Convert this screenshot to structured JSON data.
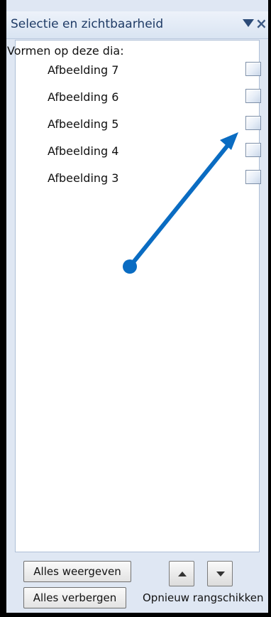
{
  "pane": {
    "title": "Selectie en zichtbaarheid",
    "list_caption": "Vormen op deze dia:",
    "shapes": [
      {
        "label": "Afbeelding 7"
      },
      {
        "label": "Afbeelding 6"
      },
      {
        "label": "Afbeelding 5"
      },
      {
        "label": "Afbeelding 4"
      },
      {
        "label": "Afbeelding 3"
      }
    ]
  },
  "footer": {
    "show_all_label": "Alles weergeven",
    "hide_all_label": "Alles verbergen",
    "reorder_label": "Opnieuw rangschikken"
  },
  "icons": {
    "menu": "dropdown-triangle",
    "close": "×",
    "visibility": "eye-toggle-box",
    "move_up": "triangle-up",
    "move_down": "triangle-down"
  },
  "colors": {
    "title_text": "#1f3b66",
    "annotation_arrow": "#0a6cc2",
    "pane_background": "#dfe7f3"
  }
}
